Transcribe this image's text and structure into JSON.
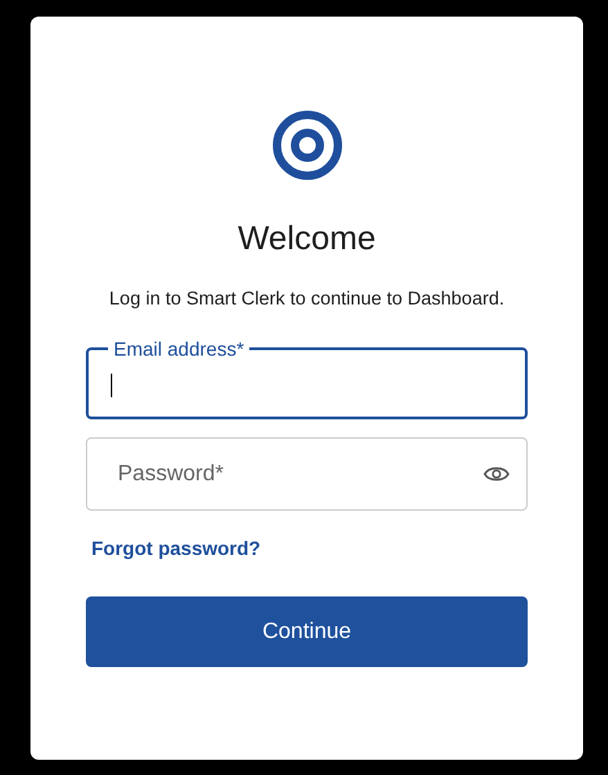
{
  "title": "Welcome",
  "subtitle": "Log in to Smart Clerk to continue to Dashboard.",
  "fields": [
    {
      "kind": "email",
      "label": "Email address*",
      "focused": true
    },
    {
      "kind": "password",
      "placeholder": "Password*",
      "focused": false
    }
  ],
  "forgot_link": "Forgot password?",
  "submit_button": "Continue"
}
